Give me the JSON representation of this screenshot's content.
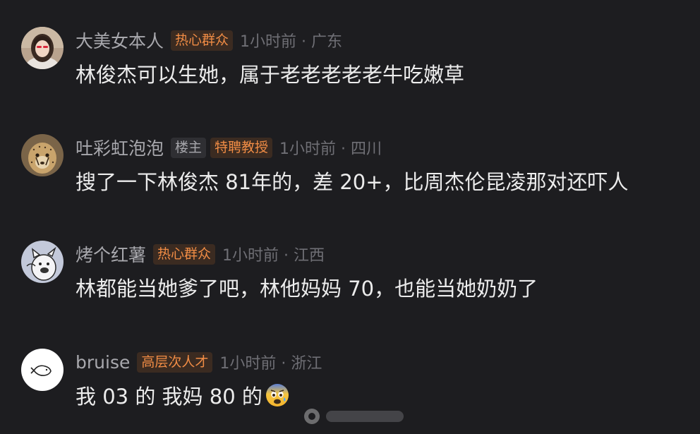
{
  "comments": [
    {
      "username": "大美女本人",
      "badges": [
        {
          "label": "热心群众",
          "style": "orange"
        }
      ],
      "time": "1小时前 · 广东",
      "text": "林俊杰可以生她，属于老老老老老牛吃嫩草",
      "avatar_icon": "woman-photo-avatar"
    },
    {
      "username": "吐彩虹泡泡",
      "badges": [
        {
          "label": "楼主",
          "style": "gray"
        },
        {
          "label": "特聘教授",
          "style": "orange"
        }
      ],
      "time": "1小时前 · 四川",
      "text": "搜了一下林俊杰 81年的，差 20+，比周杰伦昆凌那对还吓人",
      "avatar_icon": "cheetah-photo-avatar"
    },
    {
      "username": "烤个红薯",
      "badges": [
        {
          "label": "热心群众",
          "style": "orange"
        }
      ],
      "time": "1小时前 · 江西",
      "text": "林都能当她爹了吧，林他妈妈 70，也能当她奶奶了",
      "avatar_icon": "cartoon-cat-avatar"
    },
    {
      "username": "bruise",
      "badges": [
        {
          "label": "高层次人才",
          "style": "orange"
        }
      ],
      "time": "1小时前 · 浙江",
      "text": "我 03 的 我妈 80 的",
      "emoji": "anxious-face-emoji",
      "avatar_icon": "fish-doodle-avatar"
    }
  ],
  "colors": {
    "background": "#1d1d20",
    "badge_orange_text": "#f08c45",
    "badge_orange_bg": "#3b2b21",
    "badge_gray_text": "#a7a7ac",
    "badge_gray_bg": "#2f2f33",
    "username": "#a8a8ad",
    "time": "#6f6f75",
    "text": "#ececec"
  }
}
